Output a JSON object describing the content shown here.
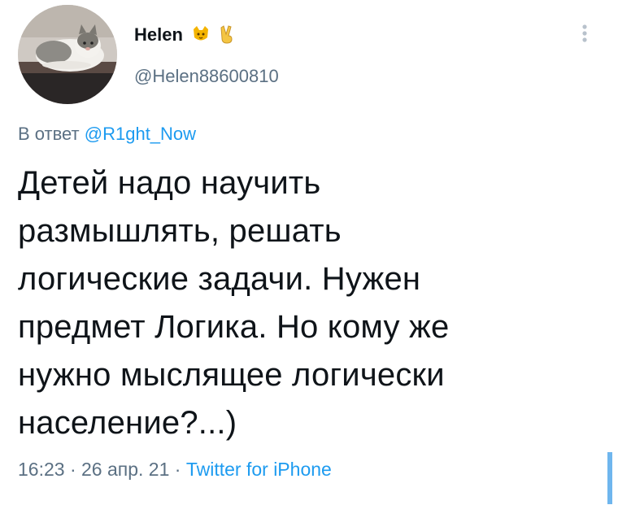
{
  "author": {
    "display_name": "Helen",
    "emoji": [
      "cat-face-icon",
      "victory-hand-icon"
    ],
    "username": "@Helen88600810"
  },
  "reply": {
    "prefix": "В ответ",
    "mention": "@R1ght_Now"
  },
  "tweet": {
    "lines": [
      "Детей надо научить",
      "размышлять, решать",
      "логические задачи. Нужен",
      "предмет Логика. Но кому же",
      "нужно мыслящее логически",
      "население?...)"
    ]
  },
  "meta": {
    "time": "16:23",
    "separator": " · ",
    "date": "26 апр. 21",
    "source": "Twitter for iPhone"
  },
  "colors": {
    "accent": "#1d9bf0",
    "secondary_text": "#5b7083",
    "primary_text": "#0f1419"
  }
}
